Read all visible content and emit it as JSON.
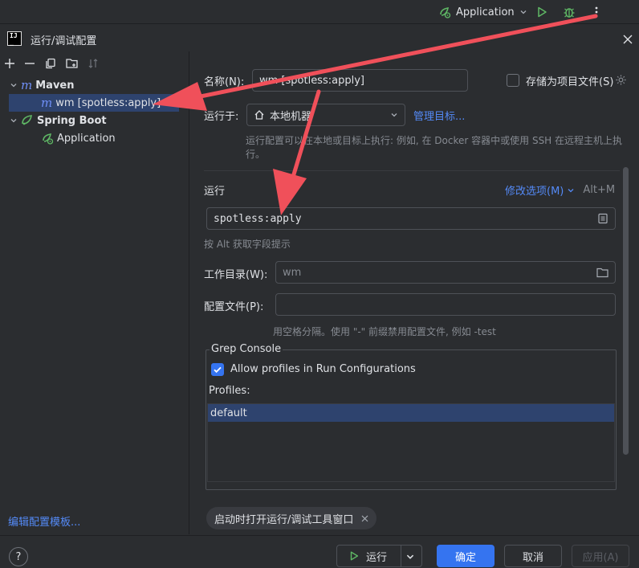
{
  "topbar": {
    "run_config_label": "Application"
  },
  "dialog": {
    "title": "运行/调试配置"
  },
  "tree": {
    "maven_label": "Maven",
    "maven_item_label": "wm [spotless:apply]",
    "springboot_label": "Spring Boot",
    "springboot_item_label": "Application",
    "edit_templates_link": "编辑配置模板..."
  },
  "form": {
    "name_label": "名称(N):",
    "name_value": "wm [spotless:apply]",
    "store_as_file_label": "存储为项目文件(S)",
    "run_on_label": "运行于:",
    "run_on_value": "本地机器",
    "manage_targets_link": "管理目标...",
    "run_on_hint": "运行配置可以在本地或目标上执行: 例如, 在 Docker 容器中或使用 SSH 在远程主机上执行。",
    "run_section_title": "运行",
    "modify_options_link": "修改选项(M)",
    "modify_options_shortcut": "Alt+M",
    "command_value": "spotless:apply",
    "alt_hint": "按 Alt 获取字段提示",
    "workdir_label": "工作目录(W):",
    "workdir_value": "wm",
    "profiles_file_label": "配置文件(P):",
    "profiles_file_value": "",
    "profiles_hint": "用空格分隔。使用 \"-\" 前缀禁用配置文件, 例如 -test"
  },
  "grep_console": {
    "legend": "Grep Console",
    "allow_profiles_label": "Allow profiles in Run Configurations",
    "allow_profiles_checked": true,
    "profiles_label": "Profiles:",
    "profiles": [
      "default"
    ]
  },
  "chip": {
    "label": "启动时打开运行/调试工具窗口"
  },
  "buttons": {
    "help": "?",
    "run": "运行",
    "ok": "确定",
    "cancel": "取消",
    "apply": "应用(A)"
  },
  "colors": {
    "accent": "#3574f0",
    "link": "#548af7",
    "selection": "#2e436e",
    "annotation_arrow": "#f0505a",
    "run_green": "#5fb865"
  }
}
